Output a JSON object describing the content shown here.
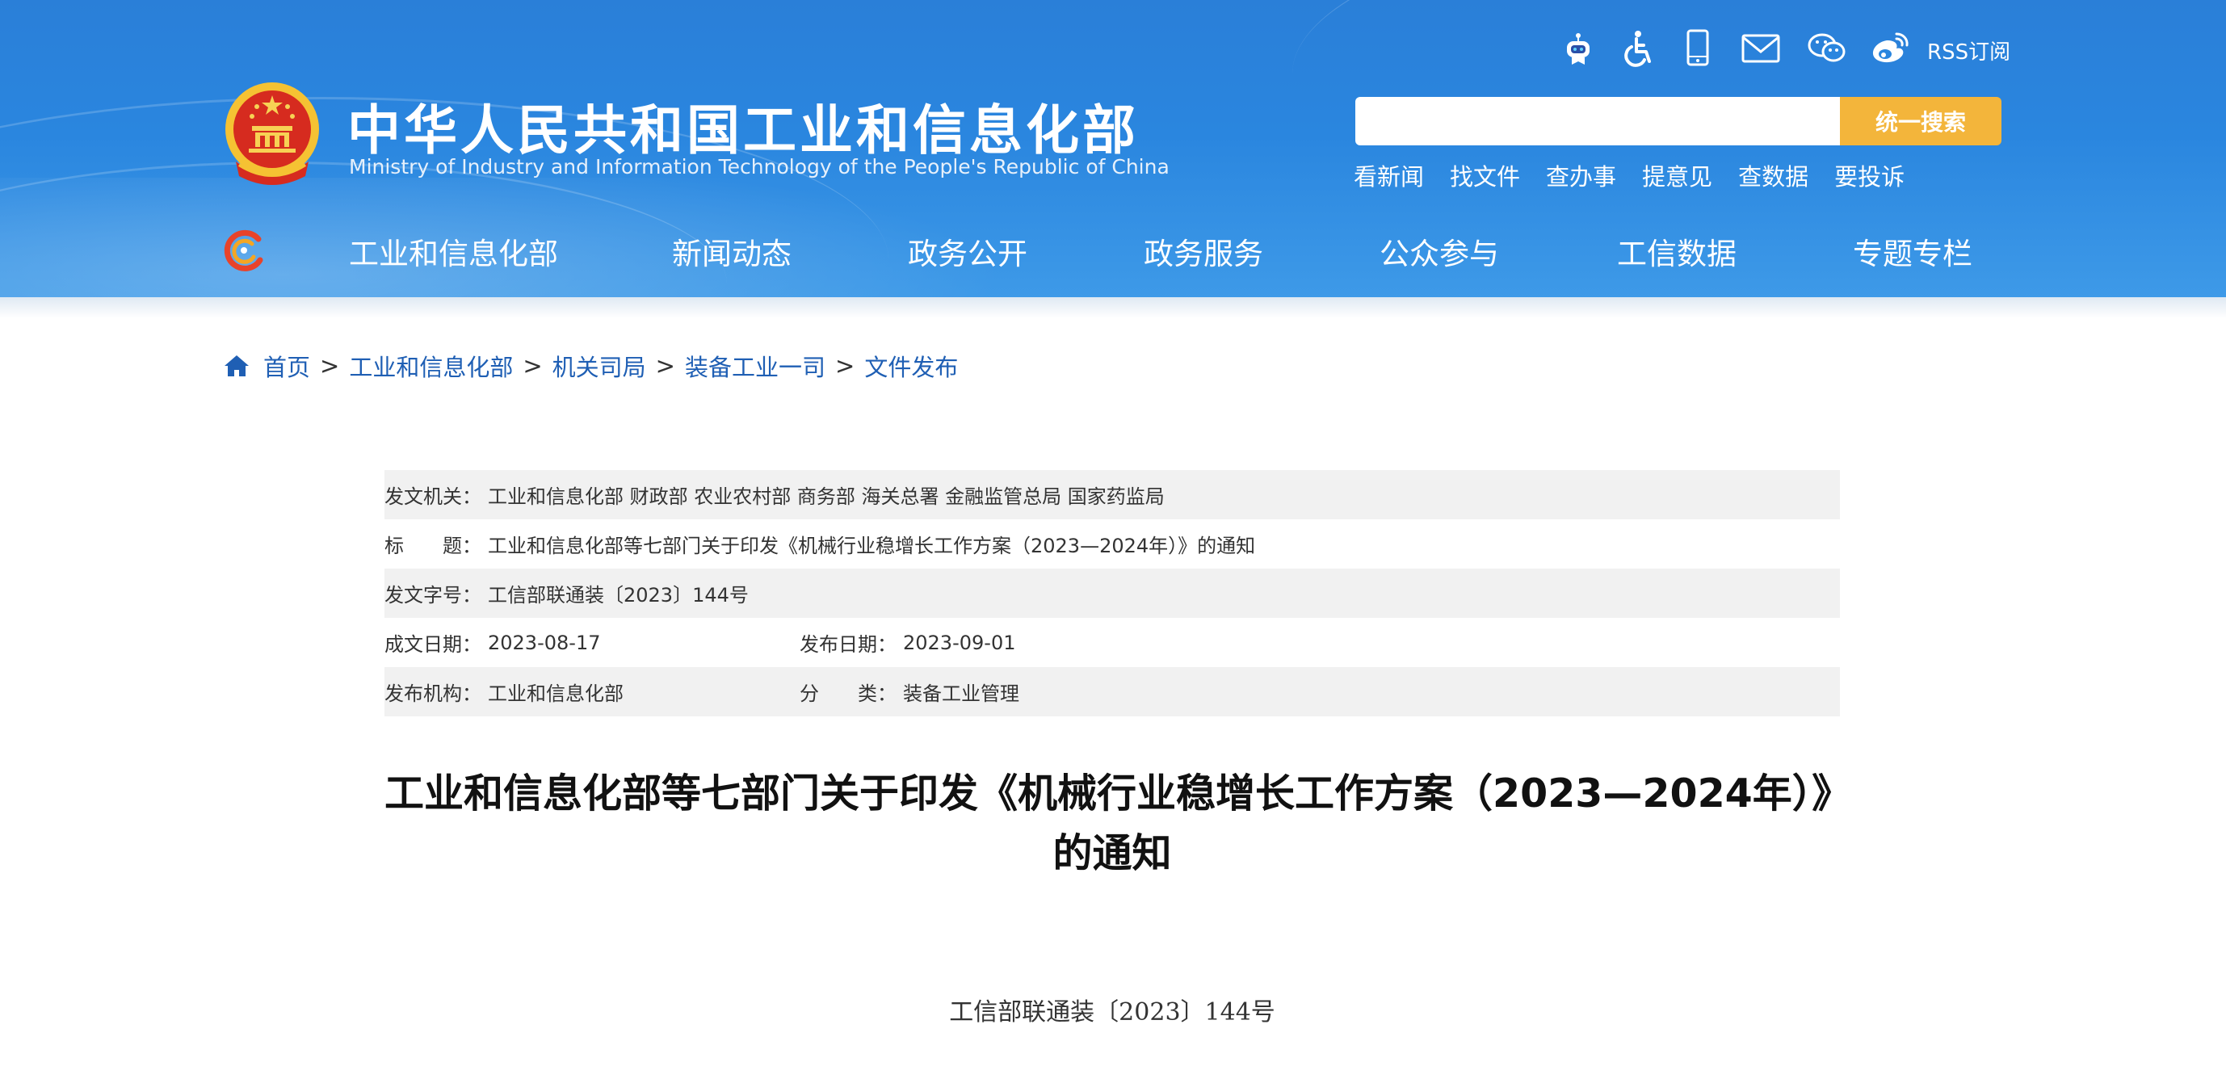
{
  "header": {
    "site_title": "中华人民共和国工业和信息化部",
    "site_subtitle": "Ministry of Industry and Information Technology of the People's Republic of China",
    "rss_label": "RSS订阅",
    "top_icons": [
      "ai-assistant-icon",
      "accessibility-icon",
      "mobile-icon",
      "mail-icon",
      "wechat-icon",
      "weibo-icon"
    ],
    "search_placeholder": "",
    "search_button": "统一搜索",
    "quick_links": [
      "看新闻",
      "找文件",
      "查办事",
      "提意见",
      "查数据",
      "要投诉"
    ],
    "nav": [
      "工业和信息化部",
      "新闻动态",
      "政务公开",
      "政务服务",
      "公众参与",
      "工信数据",
      "专题专栏"
    ]
  },
  "breadcrumb": {
    "items": [
      "首页",
      "工业和信息化部",
      "机关司局",
      "装备工业一司",
      "文件发布"
    ],
    "separator": ">"
  },
  "info": {
    "issuer_label": "发文机关：",
    "issuer_value": "工业和信息化部 财政部 农业农村部 商务部 海关总署 金融监管总局 国家药监局",
    "title_label": "标　　题：",
    "title_value": "工业和信息化部等七部门关于印发《机械行业稳增长工作方案（2023—2024年）》的通知",
    "doc_no_label": "发文字号：",
    "doc_no_value": "工信部联通装〔2023〕144号",
    "created_label": "成文日期：",
    "created_value": "2023-08-17",
    "published_label": "发布日期：",
    "published_value": "2023-09-01",
    "org_label": "发布机构：",
    "org_value": "工业和信息化部",
    "category_label": "分　　类：",
    "category_value": "装备工业管理"
  },
  "document": {
    "title_line1": "工业和信息化部等七部门关于印发《机械行业稳增长工作方案（2023—2024年）》",
    "title_line2": "的通知",
    "doc_number": "工信部联通装〔2023〕144号"
  },
  "colors": {
    "header_blue": "#2a86df",
    "search_button": "#f3b53b",
    "link_blue": "#1f5fb4",
    "shaded_row": "#f1f1f1"
  }
}
